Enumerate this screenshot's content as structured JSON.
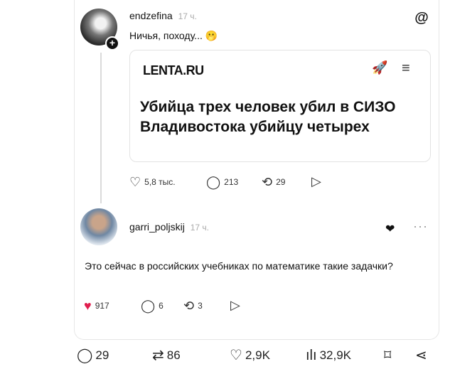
{
  "post1": {
    "username": "endzefina",
    "time": "17 ч.",
    "text": "Ничья, походу...",
    "emoji": "🫢",
    "embed": {
      "source": "LENTA.RU",
      "headline": "Убийца трех человек убил в СИЗО Владивостока убийцу четырех"
    },
    "actions": {
      "likes": "5,8 тыс.",
      "comments": "213",
      "reposts": "29"
    }
  },
  "post2": {
    "username": "garri_poljskij",
    "time": "17 ч.",
    "text": "Это сейчас в российских учебниках по математике такие задачки?",
    "actions": {
      "likes": "917",
      "comments": "6",
      "reposts": "3"
    }
  },
  "bottom": {
    "comments": "29",
    "reposts": "86",
    "likes": "2,9K",
    "views": "32,9K"
  },
  "icons": {
    "threads": "threads-logo-icon",
    "heart": "heart-icon",
    "comment": "comment-icon",
    "repost": "repost-icon",
    "share": "send-icon",
    "bookmark": "bookmark-icon"
  },
  "colors": {
    "like_active": "#e01e4e",
    "muted": "#aaaaaa"
  }
}
